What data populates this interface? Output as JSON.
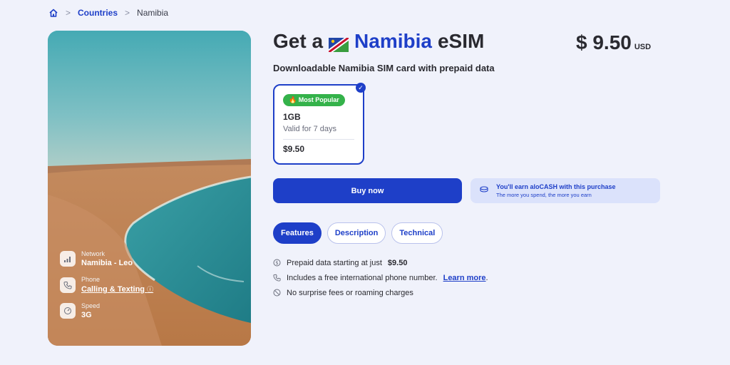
{
  "breadcrumb": {
    "link": "Countries",
    "current": "Namibia",
    "sep": ">"
  },
  "title": {
    "prefix": "Get a",
    "country": "Namibia",
    "suffix": "eSIM"
  },
  "price": {
    "amount": "$ 9.50",
    "currency": "USD"
  },
  "subtitle": "Downloadable Namibia SIM card with prepaid data",
  "plan": {
    "badge": "🔥 Most Popular",
    "size": "1GB",
    "validity": "Valid for 7 days",
    "price": "$9.50",
    "selected": true
  },
  "buy_label": "Buy now",
  "earn": {
    "title": "You'll earn aloCASH with this purchase",
    "subtitle": "The more you spend, the more you earn"
  },
  "tabs": [
    {
      "label": "Features",
      "active": true
    },
    {
      "label": "Description",
      "active": false
    },
    {
      "label": "Technical",
      "active": false
    }
  ],
  "features": [
    {
      "icon": "prepaid-icon",
      "text": "Prepaid data starting at just",
      "bold": "$9.50"
    },
    {
      "icon": "phone-icon",
      "text": "Includes a free international phone number.",
      "link": "Learn more",
      "after": "."
    },
    {
      "icon": "no-fees-icon",
      "text": "No surprise fees or roaming charges"
    }
  ],
  "hero": {
    "network": {
      "label": "Network",
      "value": "Namibia - Leo"
    },
    "phone": {
      "label": "Phone",
      "value": "Calling & Texting"
    },
    "speed": {
      "label": "Speed",
      "value": "3G"
    }
  },
  "colors": {
    "accent": "#1e3fc8",
    "badge": "#34b24a",
    "background": "#f0f2fb"
  }
}
